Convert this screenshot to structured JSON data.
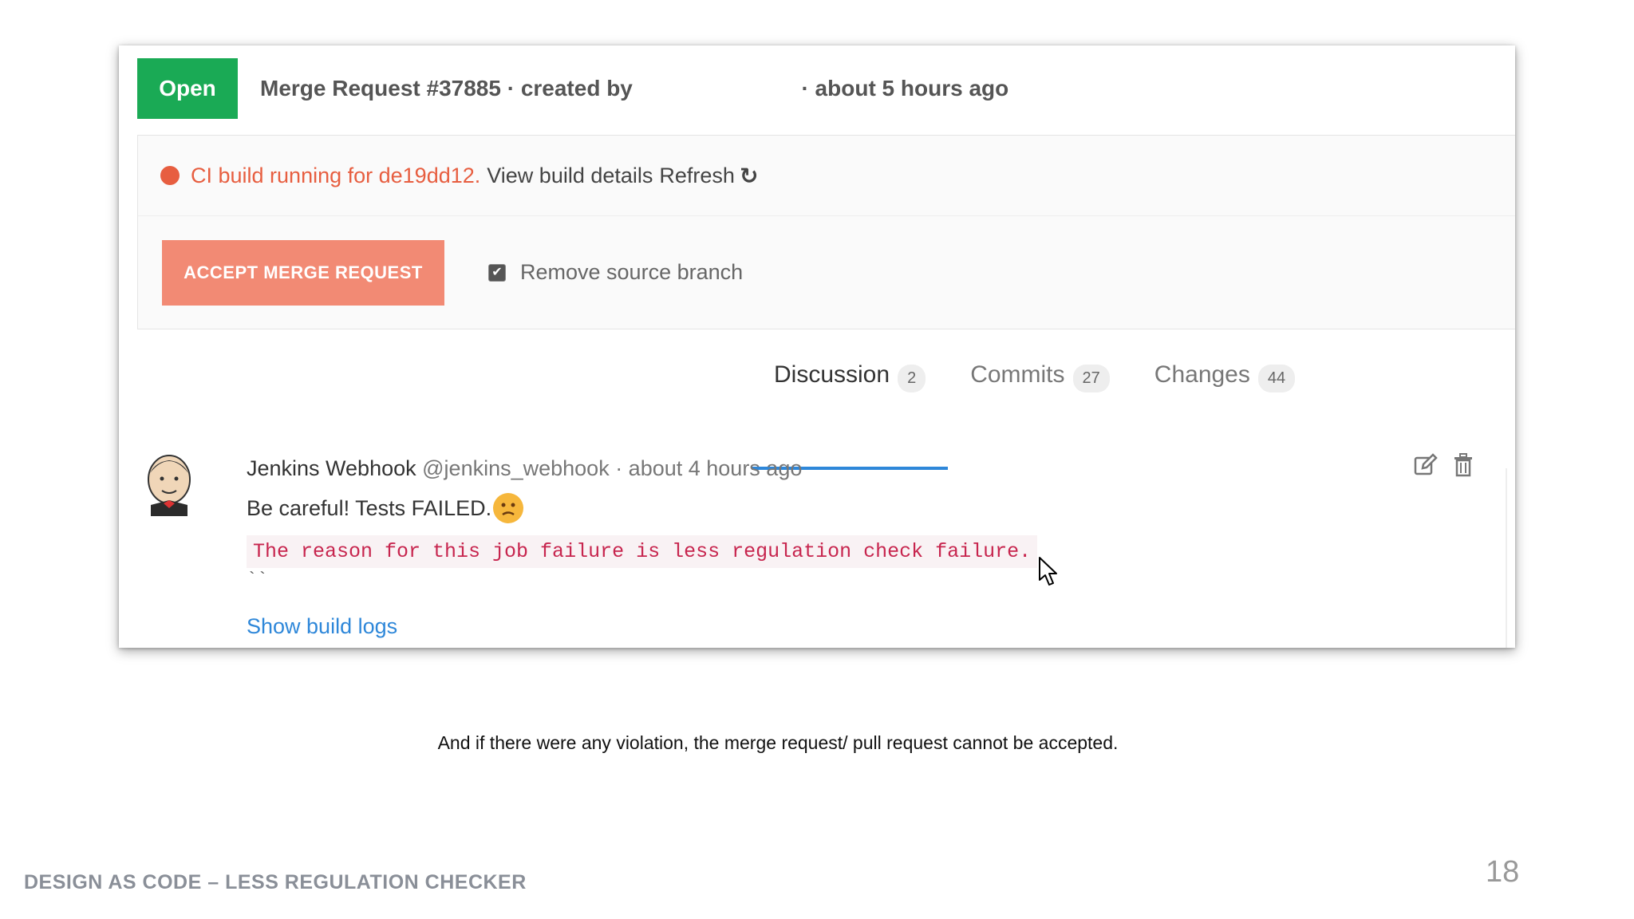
{
  "header": {
    "state": "Open",
    "title": "Merge Request #37885 · created by",
    "time": "· about 5 hours ago"
  },
  "ci": {
    "status": "CI build running for de19dd12.",
    "details_link": "View build details",
    "refresh_label": "Refresh"
  },
  "merge": {
    "accept_label": "ACCEPT MERGE REQUEST",
    "remove_branch_label": "Remove source branch",
    "remove_branch_checked": true
  },
  "tabs": [
    {
      "label": "Discussion",
      "count": "2"
    },
    {
      "label": "Commits",
      "count": "27"
    },
    {
      "label": "Changes",
      "count": "44"
    }
  ],
  "note": {
    "author": "Jenkins Webhook",
    "handle_time": "@jenkins_webhook · about 4 hours ago",
    "body": "Be careful! Tests FAILED.",
    "code": "The reason for this job failure is less regulation check failure.",
    "backticks": "``",
    "show_logs": "Show build logs"
  },
  "caption": "And if there were any violation, the merge request/ pull request cannot be accepted.",
  "footer": {
    "title": "DESIGN AS CODE – LESS REGULATION CHECKER",
    "page_number": "18"
  },
  "colors": {
    "open_badge": "#1aaa55",
    "ci_running": "#e75e40",
    "accept_button": "#f28a74",
    "link": "#2e87d9",
    "code_text": "#c7254e"
  }
}
